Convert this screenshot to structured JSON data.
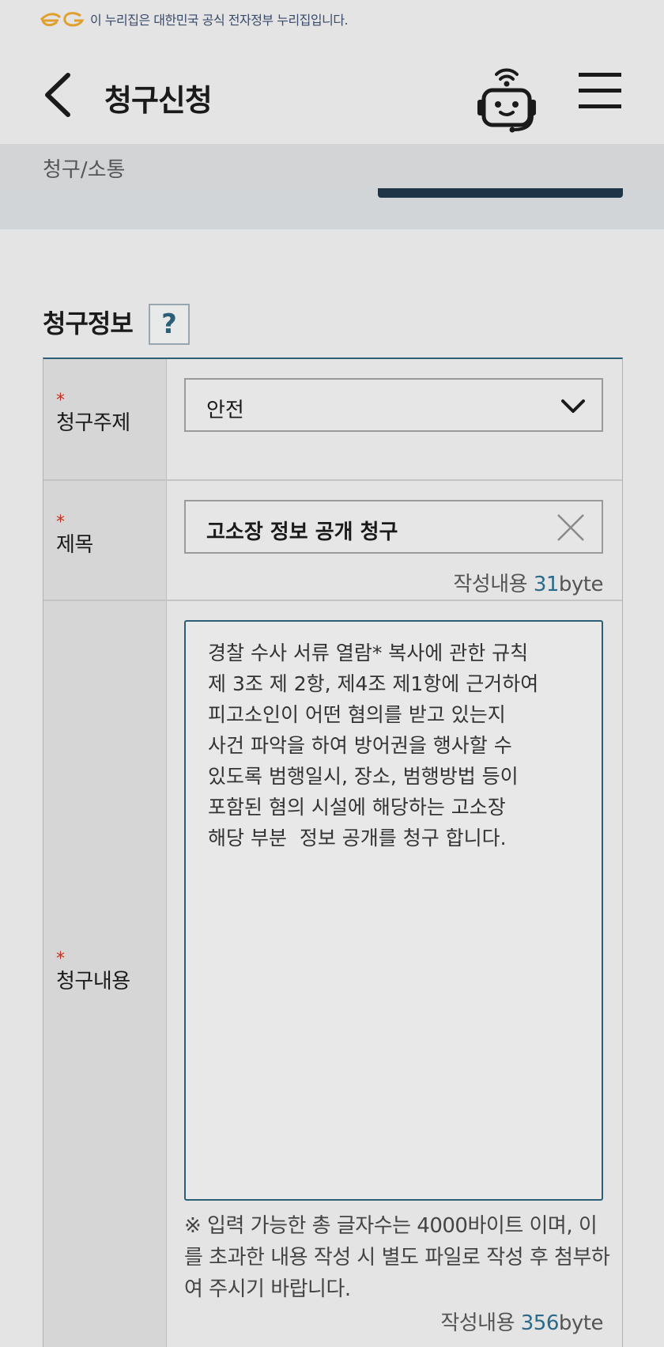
{
  "gov_banner": {
    "text": "이 누리집은 대한민국 공식 전자정부 누리집입니다."
  },
  "header": {
    "title": "청구신청"
  },
  "breadcrumb": {
    "text": "청구/소통"
  },
  "section": {
    "title": "청구정보",
    "help_label": "?"
  },
  "form": {
    "required_mark": "*",
    "topic": {
      "label": "청구주제",
      "value": "안전"
    },
    "subject": {
      "label": "제목",
      "value": "고소장 정보 공개 청구",
      "byte_prefix": "작성내용 ",
      "byte_count": "31",
      "byte_suffix": "byte"
    },
    "content": {
      "label": "청구내용",
      "lines": [
        "경찰 수사 서류 열람* 복사에 관한 규칙",
        "제 3조 제 2항, 제4조 제1항에 근거하여",
        "피고소인이 어떤 혐의를 받고 있는지",
        "사건 파악을 하여 방어권을 행사할 수",
        "있도록 범행일시, 장소, 범행방법 등이",
        "포함된 혐의 시설에 해당하는 고소장",
        "해당 부분  정보 공개를 청구 합니다."
      ],
      "note": "※ 입력 가능한 총 글자수는 4000바이트 이며, 이를 초과한 내용 작성 시 별도 파일로 작성 후 첨부하여 주시기 바랍니다.",
      "byte_prefix": "작성내용 ",
      "byte_count": "356",
      "byte_suffix": "byte"
    }
  },
  "colors": {
    "accent": "#2a5f77",
    "required": "#c03020",
    "logo": "#e0a030",
    "tab": "#1f3447"
  }
}
